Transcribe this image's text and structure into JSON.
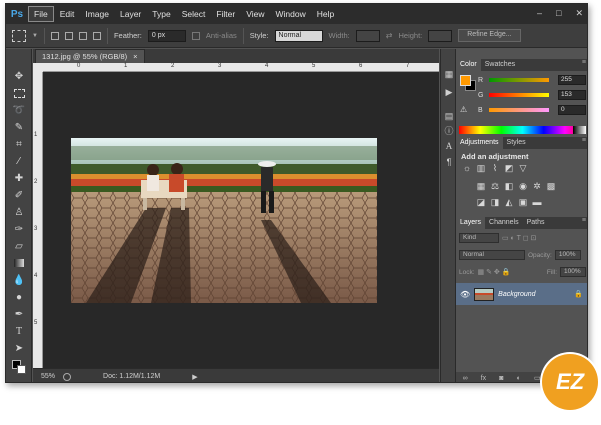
{
  "app": {
    "logo": "Ps"
  },
  "menubar": {
    "items": [
      "File",
      "Edit",
      "Image",
      "Layer",
      "Type",
      "Select",
      "Filter",
      "View",
      "Window",
      "Help"
    ],
    "active": "File",
    "window_controls": [
      "–",
      "□",
      "✕"
    ]
  },
  "options_bar": {
    "feather_label": "Feather:",
    "feather_value": "0 px",
    "antialias_label": "Anti-alias",
    "style_label": "Style:",
    "style_value": "Normal",
    "width_label": "Width:",
    "height_label": "Height:",
    "refine_label": "Refine Edge..."
  },
  "document": {
    "tab_title": "1312.jpg @ 55% (RGB/8)",
    "tab_close": "×",
    "ruler_h": [
      "0",
      "1",
      "2",
      "3",
      "4",
      "5",
      "6",
      "7"
    ],
    "ruler_v": [
      "1",
      "2",
      "3",
      "4",
      "5"
    ]
  },
  "status": {
    "zoom": "55%",
    "doc": "Doc: 1.12M/1.12M"
  },
  "color_panel": {
    "tabs": [
      "Color",
      "Swatches"
    ],
    "channels": [
      {
        "label": "R",
        "value": "255",
        "color": "#ff0000"
      },
      {
        "label": "G",
        "value": "153",
        "color": "#00ff00"
      },
      {
        "label": "B",
        "value": "0",
        "color": "#0000ff"
      }
    ],
    "foreground": "#ff9900"
  },
  "adjustments_panel": {
    "tabs": [
      "Adjustments",
      "Styles"
    ],
    "title": "Add an adjustment"
  },
  "layers_panel": {
    "tabs": [
      "Layers",
      "Channels",
      "Paths"
    ],
    "kind_label": "Kind",
    "blend_mode": "Normal",
    "opacity_label": "Opacity:",
    "opacity_value": "100%",
    "lock_label": "Lock:",
    "fill_label": "Fill:",
    "fill_value": "100%",
    "layer_name": "Background"
  },
  "watermark": {
    "text": "EZ"
  }
}
